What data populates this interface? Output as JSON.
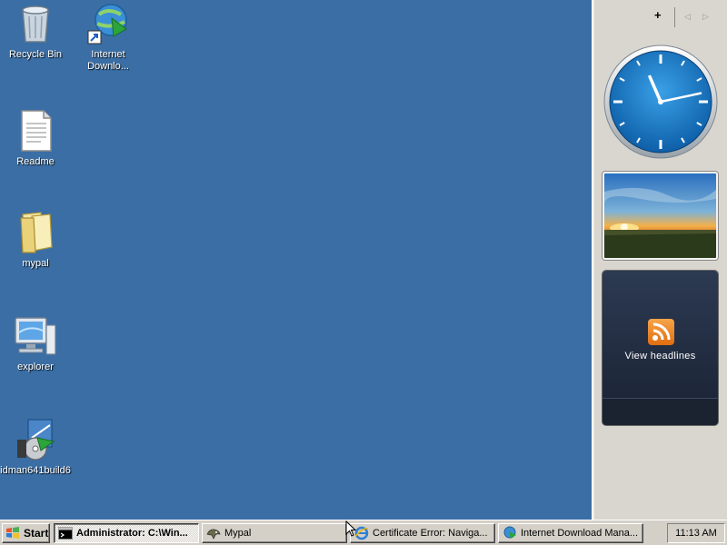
{
  "desktop": {
    "background_color": "#3a6ea5",
    "icons": [
      {
        "label": "Recycle Bin",
        "icon": "recycle-bin-icon"
      },
      {
        "label": "Internet\nDownlo...",
        "icon": "internet-download-manager-icon"
      },
      {
        "label": "Readme",
        "icon": "text-document-icon"
      },
      {
        "label": "mypal",
        "icon": "folder-icon"
      },
      {
        "label": "explorer",
        "icon": "computer-icon"
      },
      {
        "label": "idman641build6",
        "icon": "installer-icon"
      }
    ]
  },
  "sidebar": {
    "add_label": "+",
    "prev_label": "◁",
    "next_label": "▷",
    "feed": {
      "label": "View headlines"
    },
    "clock": {
      "hour": 11,
      "minute": 13
    }
  },
  "taskbar": {
    "start_label": "Start",
    "buttons": [
      {
        "label": "Administrator: C:\\Win...",
        "icon": "console-icon",
        "active": true
      },
      {
        "label": "Mypal",
        "icon": "mypal-icon",
        "active": false
      },
      {
        "label": "Certificate Error: Naviga...",
        "icon": "internet-explorer-icon",
        "active": false
      },
      {
        "label": "Internet Download Mana...",
        "icon": "internet-download-manager-icon",
        "active": false
      }
    ],
    "clock": "11:13 AM"
  }
}
